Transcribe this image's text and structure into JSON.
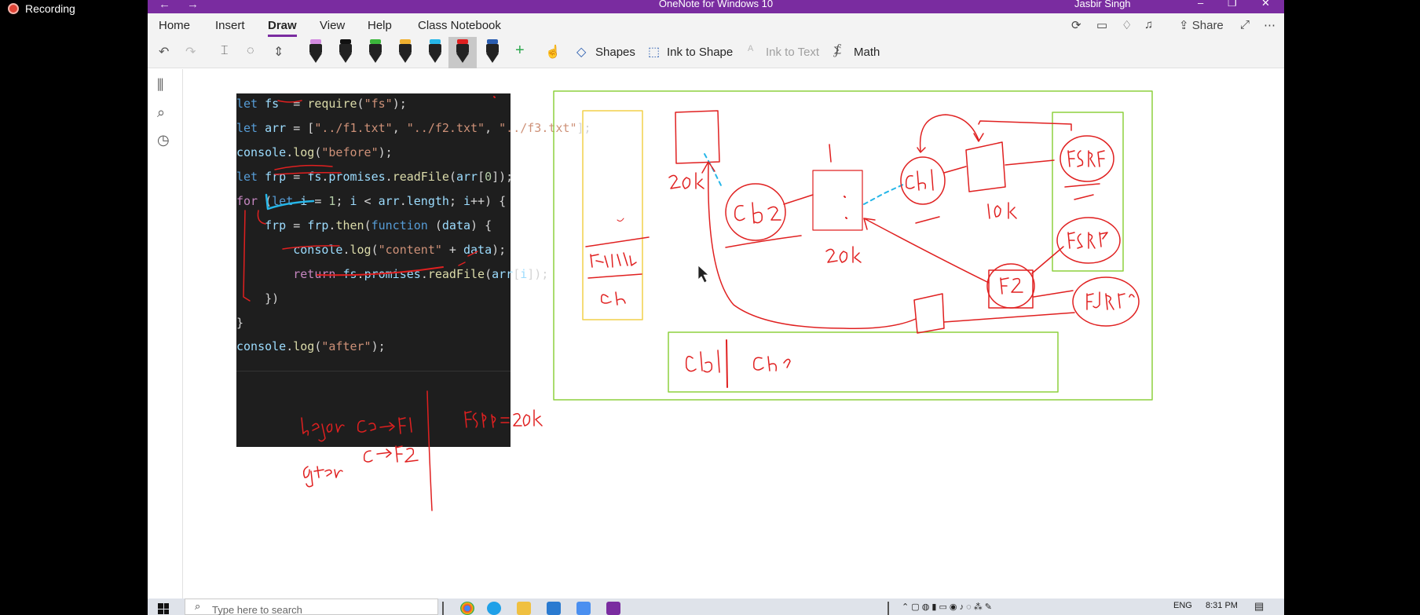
{
  "recording": {
    "label": "Recording"
  },
  "window": {
    "title": "OneNote for Windows 10",
    "user": "Jasbir Singh",
    "nav_back": "←",
    "nav_forward": "→",
    "btn_minimize": "–",
    "btn_restore": "❐",
    "btn_close": "✕"
  },
  "menu": {
    "tabs": [
      "Home",
      "Insert",
      "Draw",
      "View",
      "Help",
      "Class Notebook"
    ],
    "active_tab": "Draw",
    "share": "Share",
    "more": "⋯"
  },
  "ribbon": {
    "undo": "↶",
    "redo": "↷",
    "shapes": "Shapes",
    "ink_to_shape": "Ink to Shape",
    "ink_to_text": "Ink to Text",
    "math": "Math",
    "add_pen": "+",
    "pen_colors": [
      "#d38be0",
      "#111111",
      "#3cb63c",
      "#f0b030",
      "#26b6e8",
      "#e02020",
      "#2a5db0"
    ]
  },
  "sidebar": {
    "notebooks_icon": "⫼",
    "search_icon": "⌕",
    "recent_icon": "◷"
  },
  "code": {
    "lines": [
      {
        "parts": [
          [
            "kw",
            "let "
          ],
          [
            "var",
            "fs"
          ],
          [
            "",
            "  = "
          ],
          [
            "fn",
            "require"
          ],
          [
            "",
            "("
          ],
          [
            "str",
            "\"fs\""
          ],
          [
            "",
            ");"
          ]
        ]
      },
      {
        "parts": [
          [
            "kw",
            "let "
          ],
          [
            "var",
            "arr"
          ],
          [
            "",
            " = ["
          ],
          [
            "str",
            "\"../f1.txt\""
          ],
          [
            "",
            ", "
          ],
          [
            "str",
            "\"../f2.txt\""
          ],
          [
            "",
            ", "
          ],
          [
            "str",
            "\"../f3.txt\""
          ],
          [
            "",
            "];"
          ]
        ]
      },
      {
        "parts": [
          [
            "var",
            "console"
          ],
          [
            "",
            "."
          ],
          [
            "fn",
            "log"
          ],
          [
            "",
            "("
          ],
          [
            "str",
            "\"before\""
          ],
          [
            "",
            ");"
          ]
        ]
      },
      {
        "parts": [
          [
            "kw",
            "let "
          ],
          [
            "var",
            "frp"
          ],
          [
            "",
            " = "
          ],
          [
            "var",
            "fs"
          ],
          [
            "",
            "."
          ],
          [
            "var",
            "promises"
          ],
          [
            "",
            "."
          ],
          [
            "fn",
            "readFile"
          ],
          [
            "",
            "("
          ],
          [
            "var",
            "arr"
          ],
          [
            "",
            "["
          ],
          [
            "num",
            "0"
          ],
          [
            "",
            "]);"
          ]
        ]
      },
      {
        "parts": [
          [
            "kw2",
            "for "
          ],
          [
            "",
            "("
          ],
          [
            "kw",
            "let "
          ],
          [
            "var",
            "i"
          ],
          [
            "",
            " = "
          ],
          [
            "num",
            "1"
          ],
          [
            "",
            "; "
          ],
          [
            "var",
            "i"
          ],
          [
            "",
            " < "
          ],
          [
            "var",
            "arr"
          ],
          [
            "",
            "."
          ],
          [
            "var",
            "length"
          ],
          [
            "",
            "; "
          ],
          [
            "var",
            "i"
          ],
          [
            "",
            "++) {"
          ]
        ]
      },
      {
        "parts": [
          [
            "",
            "    "
          ],
          [
            "var",
            "frp"
          ],
          [
            "",
            " = "
          ],
          [
            "var",
            "frp"
          ],
          [
            "",
            "."
          ],
          [
            "fn",
            "then"
          ],
          [
            "",
            "("
          ],
          [
            "kw",
            "function "
          ],
          [
            "",
            "("
          ],
          [
            "var",
            "data"
          ],
          [
            "",
            ") {"
          ]
        ]
      },
      {
        "parts": [
          [
            "",
            "        "
          ],
          [
            "var",
            "console"
          ],
          [
            "",
            "."
          ],
          [
            "fn",
            "log"
          ],
          [
            "",
            "("
          ],
          [
            "str",
            "\"content\""
          ],
          [
            "",
            " + "
          ],
          [
            "var",
            "data"
          ],
          [
            "",
            ");"
          ]
        ]
      },
      {
        "parts": [
          [
            "",
            "        "
          ],
          [
            "kw2",
            "return "
          ],
          [
            "var",
            "fs"
          ],
          [
            "",
            "."
          ],
          [
            "var",
            "promises"
          ],
          [
            "",
            "."
          ],
          [
            "fn",
            "readFile"
          ],
          [
            "",
            "("
          ],
          [
            "var",
            "arr"
          ],
          [
            "",
            "["
          ],
          [
            "var",
            "i"
          ],
          [
            "",
            "]);"
          ]
        ]
      },
      {
        "parts": [
          [
            "",
            "    })"
          ]
        ]
      },
      {
        "parts": [
          [
            "",
            "}"
          ]
        ]
      },
      {
        "parts": [
          [
            "var",
            "console"
          ],
          [
            "",
            "."
          ],
          [
            "fn",
            "log"
          ],
          [
            "",
            "("
          ],
          [
            "str",
            "\"after\""
          ],
          [
            "",
            ");"
          ]
        ]
      }
    ]
  },
  "taskbar": {
    "search_placeholder": "Type here to search",
    "lang": "ENG",
    "time": "8:31 PM"
  }
}
